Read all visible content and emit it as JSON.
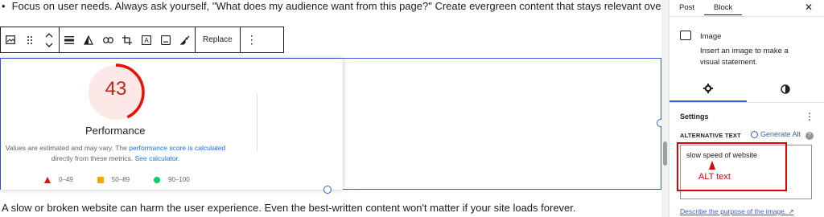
{
  "editor": {
    "bullet_text": "Focus on user needs. Always ask yourself, \"What does my audience want from this page?\" Create evergreen content that stays relevant over time.",
    "toolbar": {
      "replace_label": "Replace",
      "icons": [
        "image-icon",
        "drag-handle-icon",
        "move-up-down-icon",
        "align-icon",
        "duotone-icon",
        "link-icon",
        "crop-icon",
        "text-overlay-icon",
        "caption-icon",
        "brush-icon",
        "more-options-icon"
      ]
    },
    "image": {
      "score": "43",
      "title": "Performance",
      "note_prefix": "Values are estimated and may vary. The ",
      "note_link1": "performance score is calculated",
      "note_mid": " directly from these metrics. ",
      "note_link2": "See calculator.",
      "legend": [
        {
          "label": "0–49",
          "color": "#eb0f00"
        },
        {
          "label": "50–89",
          "color": "#ffa400"
        },
        {
          "label": "90–100",
          "color": "#0cce6b"
        }
      ],
      "gauge_fraction": 0.43,
      "gauge_color": "#eb0f00"
    },
    "paragraph_text": "A slow or broken website can harm the user experience. Even the best-written content won't matter if your site loads forever."
  },
  "sidebar": {
    "tabs": [
      "Post",
      "Block"
    ],
    "active_tab": "Block",
    "block_title": "Image",
    "block_desc": "Insert an image to make a visual statement.",
    "settings_title": "Settings",
    "alt_label": "ALTERNATIVE TEXT",
    "generate_alt": "Generate Alt",
    "alt_value": "slow speed of website",
    "annotation_label": "ALT text",
    "describe_link": "Describe the purpose of the image. ↗"
  },
  "colors": {
    "accent": "#3858e9",
    "annotation": "#e00000"
  }
}
